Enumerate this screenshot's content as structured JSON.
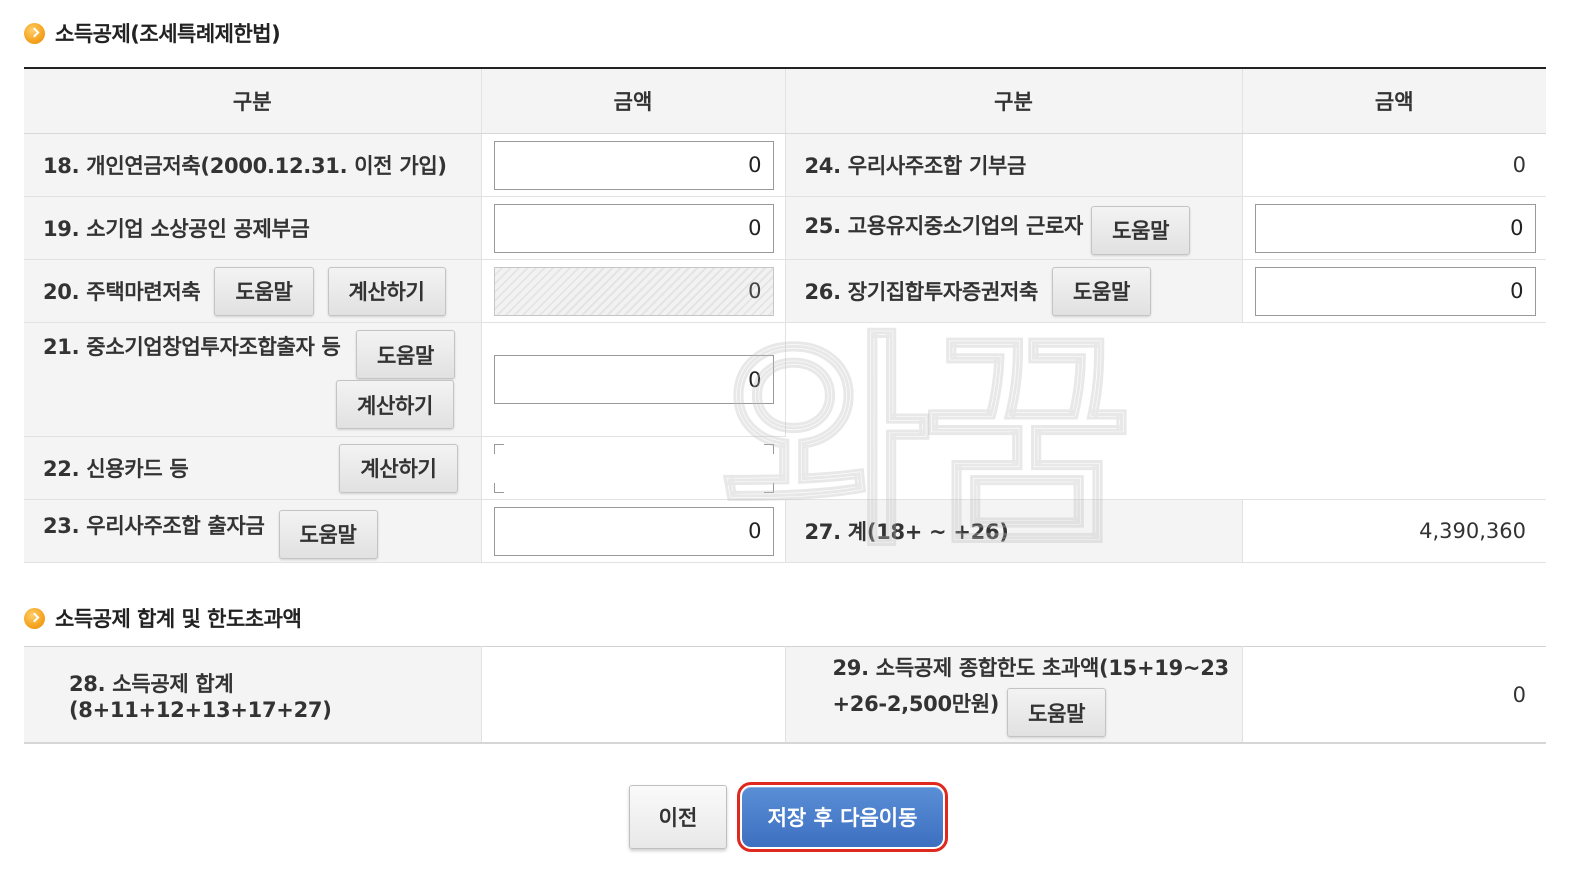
{
  "deduction_section": {
    "title": "소득공제(조세특례제한법)",
    "headers": [
      "구분",
      "금액",
      "구분",
      "금액"
    ],
    "help_label": "도움말",
    "calc_label": "계산하기",
    "left_rows": [
      {
        "label": "18. 개인연금저축(2000.12.31. 이전 가입)",
        "value": "0"
      },
      {
        "label": "19. 소기업 소상공인 공제부금",
        "value": "0"
      },
      {
        "label": "20. 주택마련저축",
        "value": "0"
      },
      {
        "label": "21. 중소기업창업투자조합출자 등",
        "value": "0"
      },
      {
        "label": "22. 신용카드 등",
        "value": ""
      },
      {
        "label": "23. 우리사주조합 출자금",
        "value": "0"
      }
    ],
    "right_rows": [
      {
        "label": "24. 우리사주조합 기부금",
        "value": "0"
      },
      {
        "label": "25. 고용유지중소기업의 근로자",
        "value": "0"
      },
      {
        "label": "26. 장기집합투자증권저축",
        "value": "0"
      },
      {
        "label": "27. 계(18+ ~ +26)",
        "value": "4,390,360"
      }
    ]
  },
  "total_section": {
    "title": "소득공제 합계 및 한도초과액",
    "row28_label": "28. 소득공제 합계(8+11+12+13+17+27)",
    "row28_value": "",
    "row29_label_line1": "29. 소득공제 종합한도 초과액(15+19~23",
    "row29_label_line2": "+26-2,500만원)",
    "row29_value": "0"
  },
  "watermark_text": "와꿈",
  "nav": {
    "prev_label": "이전",
    "next_label": "저장 후 다음이동"
  }
}
